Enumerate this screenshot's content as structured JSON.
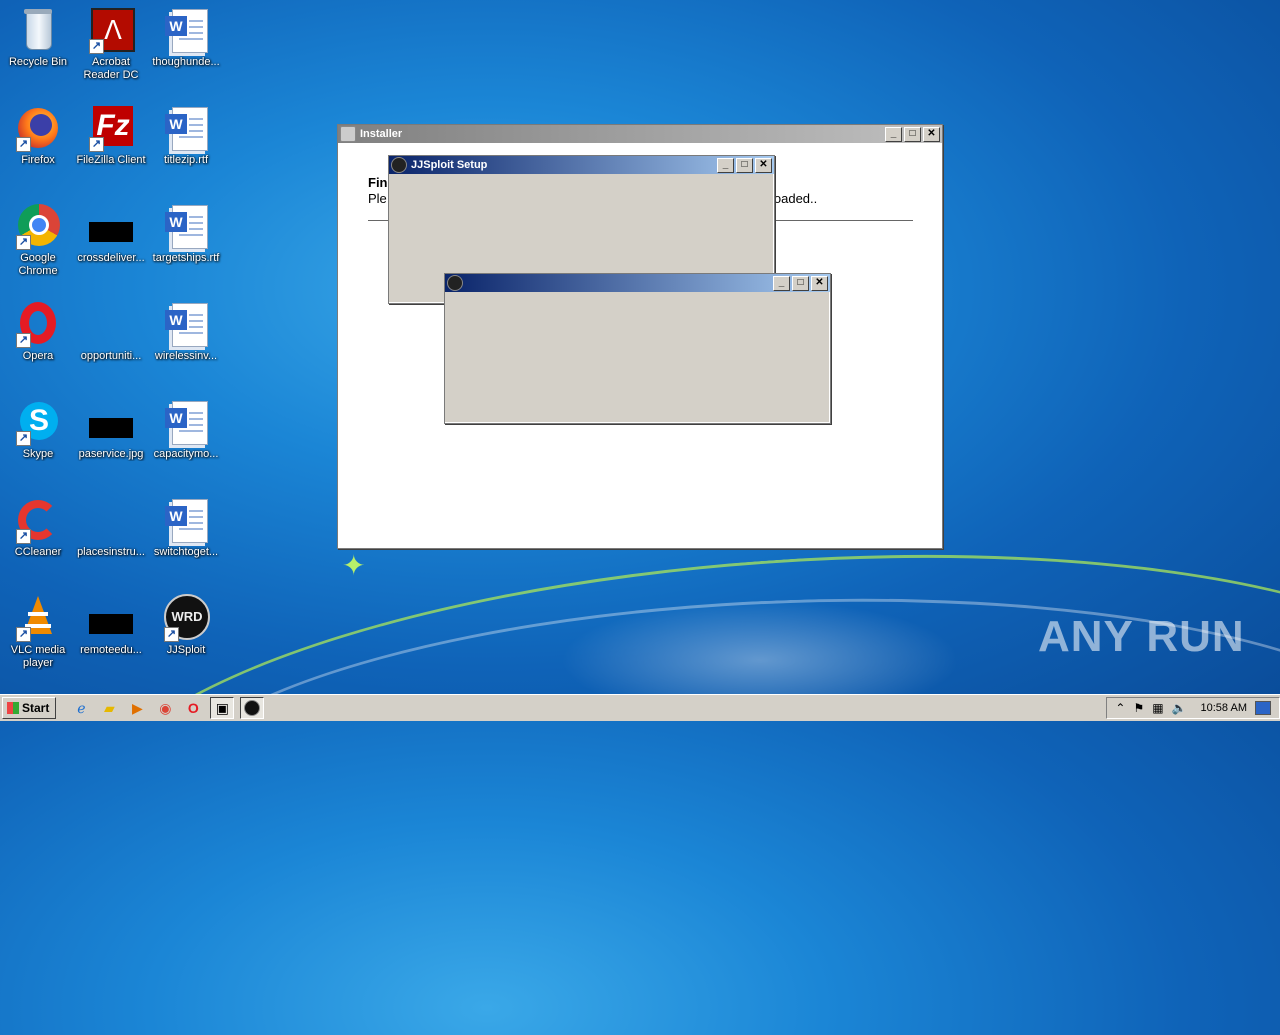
{
  "desktop": {
    "icons": [
      {
        "label": "Recycle Bin"
      },
      {
        "label": "Acrobat Reader DC"
      },
      {
        "label": "thoughunde..."
      },
      {
        "label": "Firefox"
      },
      {
        "label": "FileZilla Client"
      },
      {
        "label": "titlezip.rtf"
      },
      {
        "label": "Google Chrome"
      },
      {
        "label": "crossdeliver..."
      },
      {
        "label": "targetships.rtf"
      },
      {
        "label": "Opera"
      },
      {
        "label": "opportuniti..."
      },
      {
        "label": "wirelessinv..."
      },
      {
        "label": "Skype"
      },
      {
        "label": "paservice.jpg"
      },
      {
        "label": "capacitymo..."
      },
      {
        "label": "CCleaner"
      },
      {
        "label": "placesinstru..."
      },
      {
        "label": "switchtoget..."
      },
      {
        "label": "VLC media player"
      },
      {
        "label": "remoteedu..."
      },
      {
        "label": "JJSploit"
      }
    ]
  },
  "installer": {
    "title": "Installer",
    "heading": "Fin",
    "text_prefix": "Ple",
    "text_suffix": "loaded.."
  },
  "setup_window": {
    "title": "JJSploit Setup"
  },
  "blank_window": {
    "title": ""
  },
  "watermark": {
    "text": "ANY RUN"
  },
  "taskbar": {
    "start_label": "Start",
    "clock": "10:58 AM"
  },
  "colors": {
    "title_active": "#0a246a",
    "title_active_end": "#a6caf0",
    "title_inactive": "#808080",
    "face": "#d4d0c8"
  }
}
